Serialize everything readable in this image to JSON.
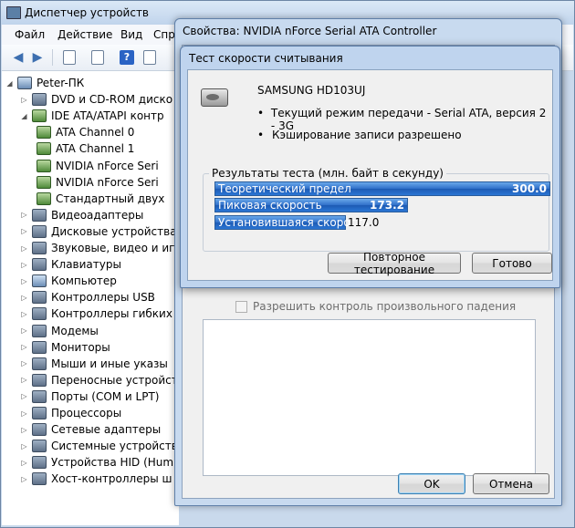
{
  "device_manager": {
    "title": "Диспетчер устройств",
    "menu": [
      "Файл",
      "Действие",
      "Вид",
      "Спра"
    ],
    "tree": [
      {
        "label": "Peter-ПК",
        "level": 0,
        "twisty": "open",
        "icon": "computer"
      },
      {
        "label": "DVD и CD-ROM диско",
        "level": 1,
        "twisty": "closed",
        "icon": "drive"
      },
      {
        "label": "IDE ATA/ATAPI контр",
        "level": 1,
        "twisty": "open",
        "icon": "controller"
      },
      {
        "label": "ATA Channel 0",
        "level": 2,
        "twisty": "none",
        "icon": "controller"
      },
      {
        "label": "ATA Channel 1",
        "level": 2,
        "twisty": "none",
        "icon": "controller"
      },
      {
        "label": "NVIDIA nForce Seri",
        "level": 2,
        "twisty": "none",
        "icon": "controller"
      },
      {
        "label": "NVIDIA nForce Seri",
        "level": 2,
        "twisty": "none",
        "icon": "controller"
      },
      {
        "label": "Стандартный двух",
        "level": 2,
        "twisty": "none",
        "icon": "controller"
      },
      {
        "label": "Видеоадаптеры",
        "level": 1,
        "twisty": "closed",
        "icon": "display"
      },
      {
        "label": "Дисковые устройства",
        "level": 1,
        "twisty": "closed",
        "icon": "drive"
      },
      {
        "label": "Звуковые, видео и игр",
        "level": 1,
        "twisty": "closed",
        "icon": "sound"
      },
      {
        "label": "Клавиатуры",
        "level": 1,
        "twisty": "closed",
        "icon": "keyboard"
      },
      {
        "label": "Компьютер",
        "level": 1,
        "twisty": "closed",
        "icon": "computer"
      },
      {
        "label": "Контроллеры USB",
        "level": 1,
        "twisty": "closed",
        "icon": "usb"
      },
      {
        "label": "Контроллеры гибких",
        "level": 1,
        "twisty": "closed",
        "icon": "floppy"
      },
      {
        "label": "Модемы",
        "level": 1,
        "twisty": "closed",
        "icon": "modem"
      },
      {
        "label": "Мониторы",
        "level": 1,
        "twisty": "closed",
        "icon": "monitor"
      },
      {
        "label": "Мыши и иные указы",
        "level": 1,
        "twisty": "closed",
        "icon": "mouse"
      },
      {
        "label": "Переносные устройст",
        "level": 1,
        "twisty": "closed",
        "icon": "portable"
      },
      {
        "label": "Порты (COM и LPT)",
        "level": 1,
        "twisty": "closed",
        "icon": "port"
      },
      {
        "label": "Процессоры",
        "level": 1,
        "twisty": "closed",
        "icon": "cpu"
      },
      {
        "label": "Сетевые адаптеры",
        "level": 1,
        "twisty": "closed",
        "icon": "network"
      },
      {
        "label": "Системные устройств",
        "level": 1,
        "twisty": "closed",
        "icon": "system"
      },
      {
        "label": "Устройства HID (Hum",
        "level": 1,
        "twisty": "closed",
        "icon": "hid"
      },
      {
        "label": "Хост-контроллеры ш",
        "level": 1,
        "twisty": "closed",
        "icon": "usb"
      }
    ]
  },
  "properties_dialog": {
    "title": "Свойства: NVIDIA nForce Serial ATA Controller",
    "checkbox_label": "Разрешить контроль произвольного падения",
    "checkbox_checked": false,
    "ok_label": "OK",
    "cancel_label": "Отмена"
  },
  "speed_test_dialog": {
    "title": "Тест скорости считывания",
    "disk_name": "SAMSUNG HD103UJ",
    "bullets": [
      "Текущий режим передачи - Serial ATA, версия 2 - 3G",
      "Кэширование записи разрешено"
    ],
    "results_group_label": "Результаты теста (млн. байт в секунду)",
    "results": [
      {
        "label": "Теоретический предел",
        "value": 300.0,
        "value_text": "300.0"
      },
      {
        "label": "Пиковая скорость",
        "value": 173.2,
        "value_text": "173.2"
      },
      {
        "label": "Установившаяся скорость",
        "value": 117.0,
        "value_text": "117.0"
      }
    ],
    "max_value": 300,
    "retest_label": "Повторное тестирование",
    "done_label": "Готово"
  },
  "colors": {
    "bar_fill": "#2f6fc9",
    "window_frame": "#c8daef"
  }
}
